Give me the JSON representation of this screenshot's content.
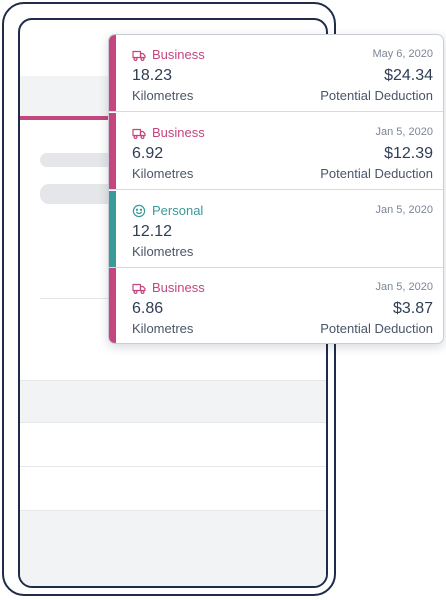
{
  "colors": {
    "business": "#c4467e",
    "personal": "#3a9a98",
    "frame": "#1e2c4a",
    "text_primary": "#2f3e55"
  },
  "trips": [
    {
      "category": "Business",
      "icon": "truck-icon",
      "date": "May 6, 2020",
      "distance": "18.23",
      "unit": "Kilometres",
      "amount": "$24.34",
      "amount_label": "Potential Deduction"
    },
    {
      "category": "Business",
      "icon": "truck-icon",
      "date": "Jan 5, 2020",
      "distance": "6.92",
      "unit": "Kilometres",
      "amount": "$12.39",
      "amount_label": "Potential Deduction"
    },
    {
      "category": "Personal",
      "icon": "smiley-icon",
      "date": "Jan 5, 2020",
      "distance": "12.12",
      "unit": "Kilometres"
    },
    {
      "category": "Business",
      "icon": "truck-icon",
      "date": "Jan 5, 2020",
      "distance": "6.86",
      "unit": "Kilometres",
      "amount": "$3.87",
      "amount_label": "Potential Deduction"
    }
  ]
}
